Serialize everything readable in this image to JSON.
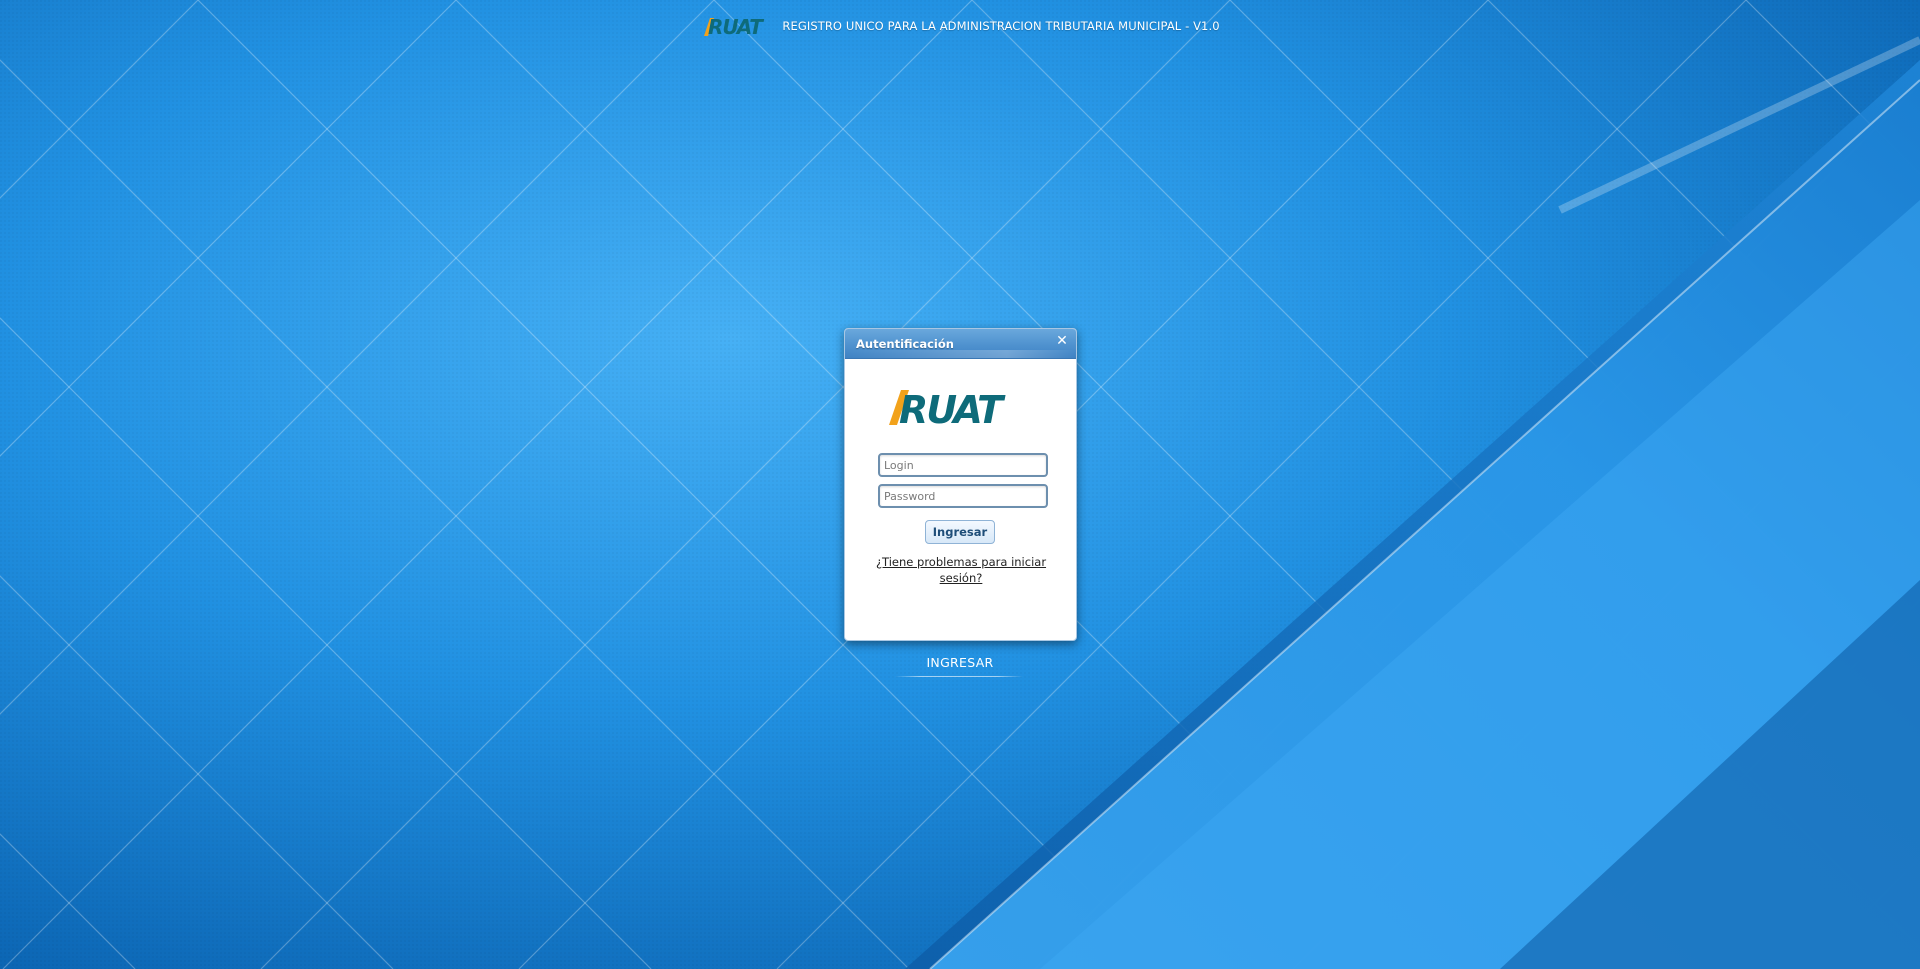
{
  "header": {
    "logo_text": "RUAT",
    "title": "REGISTRO UNICO PARA LA ADMINISTRACION TRIBUTARIA MUNICIPAL - V1.0"
  },
  "dialog": {
    "title": "Autentificación",
    "close_icon": "close-icon",
    "logo_text": "RUAT",
    "login_placeholder": "Login",
    "password_placeholder": "Password",
    "submit_label": "Ingresar",
    "help_link": "¿Tiene problemas para iniciar sesión?"
  },
  "bottom": {
    "ingresar_label": "INGRESAR"
  },
  "colors": {
    "background": "#1a87d9",
    "dialog_header": "#4f92cf",
    "logo_teal": "#0e6b7a",
    "logo_orange": "#f2a21b"
  }
}
